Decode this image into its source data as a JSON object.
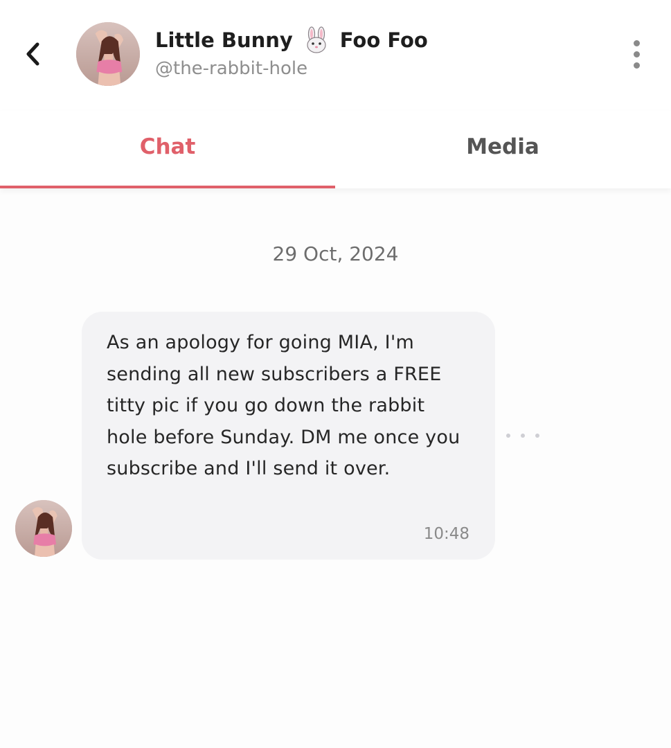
{
  "header": {
    "back_icon": "chevron-left-icon",
    "name_first": "Little Bunny",
    "name_emoji": "rabbit-face-icon",
    "name_last": "Foo Foo",
    "handle": "@the-rabbit-hole",
    "more_icon": "vertical-dots-icon"
  },
  "tabs": [
    {
      "label": "Chat",
      "active": true
    },
    {
      "label": "Media",
      "active": false
    }
  ],
  "chat": {
    "date": "29 Oct, 2024",
    "messages": [
      {
        "text": "As an apology for going MIA, I'm sending all new subscribers a FREE titty pic if you go down the rabbit hole before Sunday. DM me once you subscribe and I'll send it over.",
        "time": "10:48"
      }
    ]
  },
  "colors": {
    "accent": "#e0606a",
    "bubble": "#f3f3f5",
    "muted_text": "#8e8e8e"
  }
}
